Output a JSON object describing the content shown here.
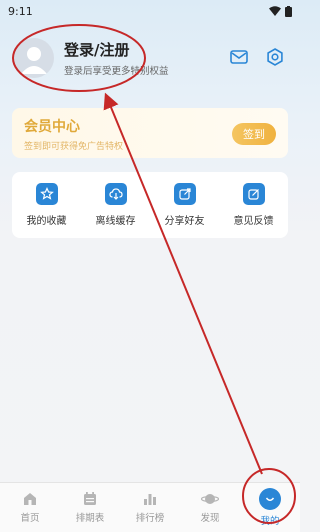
{
  "status_bar": {
    "time": "9:11"
  },
  "header": {
    "title": "登录/注册",
    "subtitle": "登录后享受更多特别权益"
  },
  "vip": {
    "title": "会员中心",
    "subtitle": "签到即可获得免广告特权",
    "signin_label": "签到"
  },
  "menu": {
    "items": [
      {
        "label": "我的收藏",
        "icon": "star-icon"
      },
      {
        "label": "离线缓存",
        "icon": "cloud-download-icon"
      },
      {
        "label": "分享好友",
        "icon": "share-icon"
      },
      {
        "label": "意见反馈",
        "icon": "feedback-icon"
      }
    ]
  },
  "tabbar": {
    "items": [
      {
        "label": "首页",
        "icon": "home-icon"
      },
      {
        "label": "排期表",
        "icon": "calendar-icon"
      },
      {
        "label": "排行榜",
        "icon": "ranking-icon"
      },
      {
        "label": "发现",
        "icon": "planet-icon"
      },
      {
        "label": "我的",
        "icon": "profile-icon",
        "active": true
      }
    ]
  },
  "colors": {
    "accent": "#2a86d6",
    "vip_gold": "#e0a93a",
    "annotation_red": "#c62828"
  }
}
